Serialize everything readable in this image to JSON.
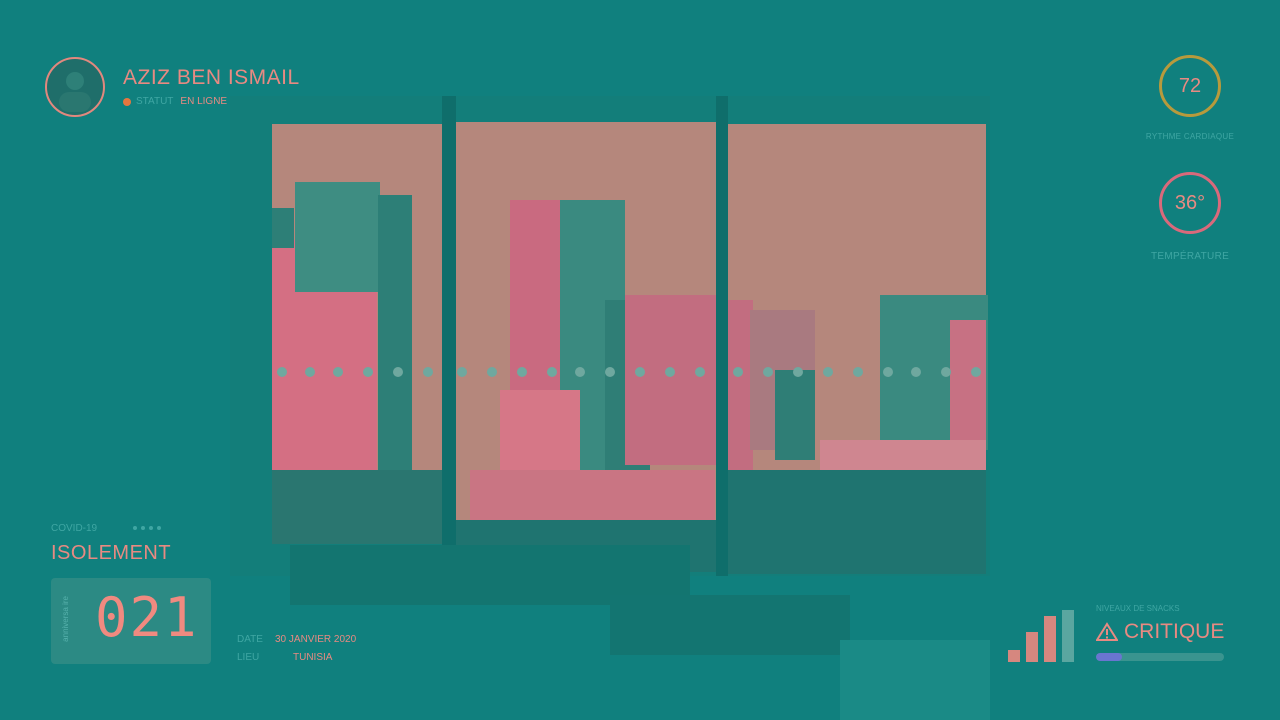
{
  "profile": {
    "name": "AZIZ BEN ISMAIL",
    "status_label": "STATUT",
    "status_value": "EN LIGNE"
  },
  "vitals": {
    "heart_rate": {
      "value": "72",
      "label": "RYTHME CARDIAQUE"
    },
    "temperature": {
      "value": "36°",
      "label": "TEMPÉRATURE"
    }
  },
  "isolation": {
    "caption": "COVID-19",
    "title": "ISOLEMENT",
    "counter_side": "anniversa ire",
    "counter_value": "021",
    "date_label": "DATE",
    "date_value": "30 JANVIER 2020",
    "place_label": "LIEU",
    "place_value": "TUNISIA"
  },
  "snacks": {
    "caption": "NIVEAUX DE SNACKS",
    "status": "CRITIQUE",
    "level": 0.2
  },
  "colors": {
    "background": "#10807e",
    "accent": "#e88a82",
    "muted": "#3fa6a3",
    "status_dot": "#e6763f",
    "progress": "#6a75d0"
  }
}
